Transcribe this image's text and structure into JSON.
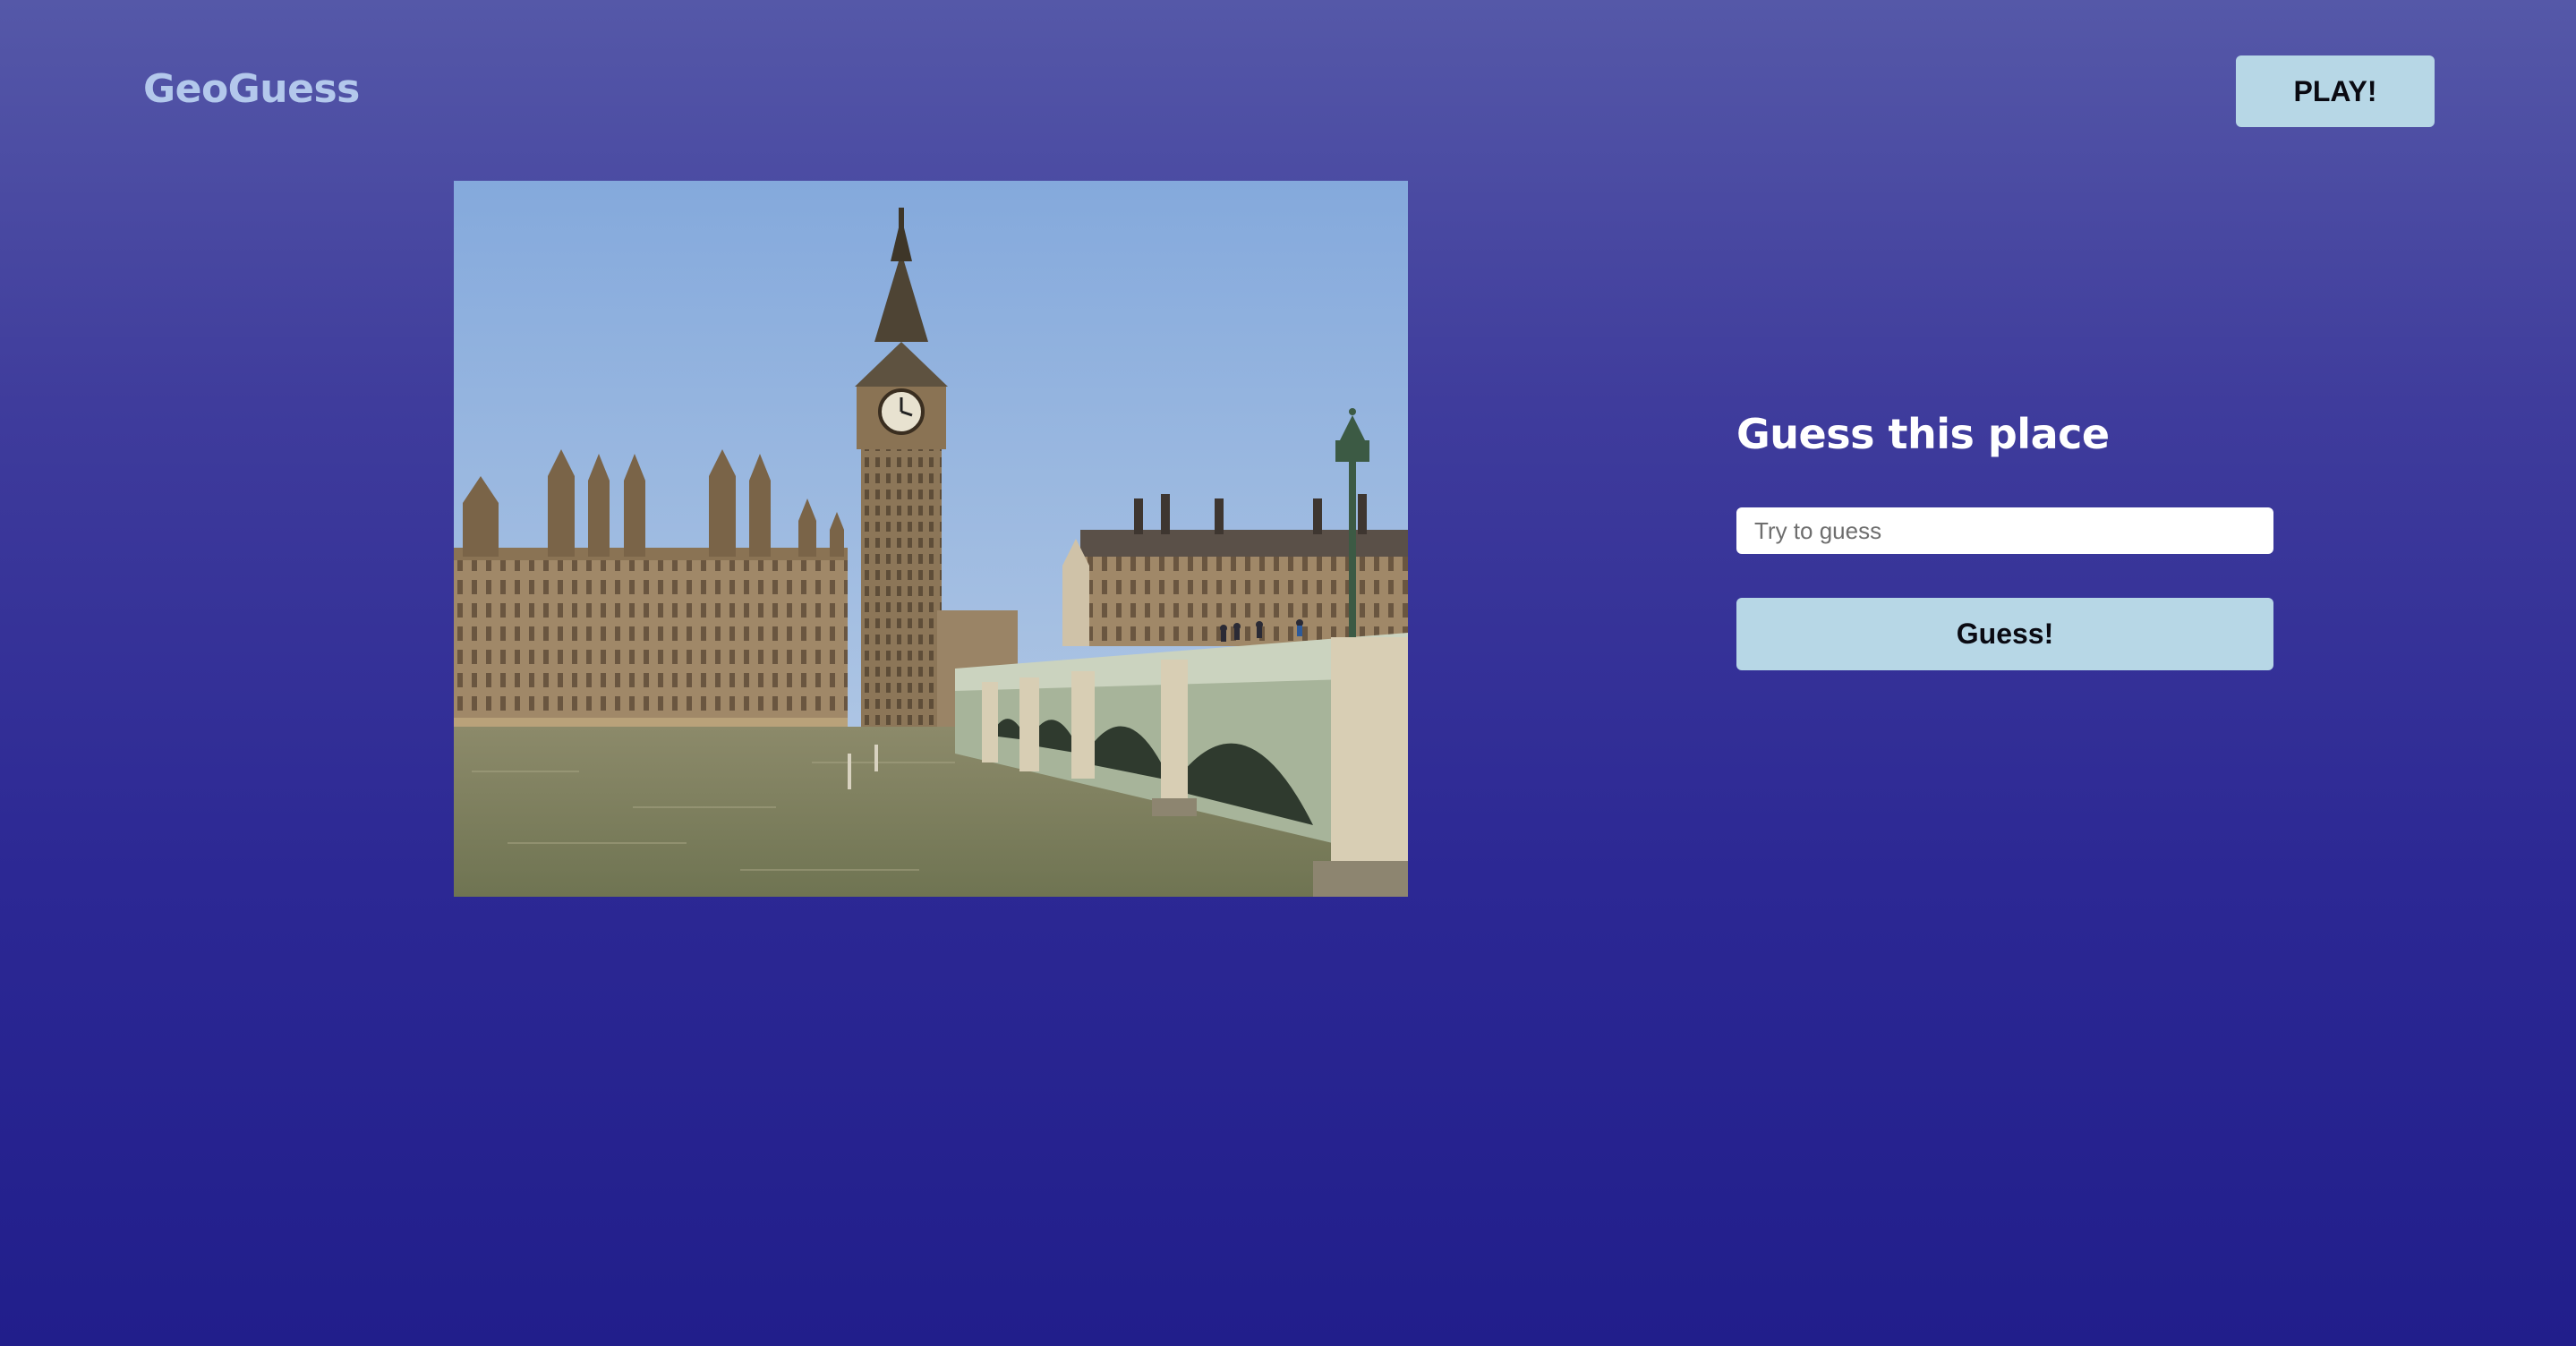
{
  "header": {
    "logo_text": "GeoGuess",
    "play_label": "PLAY!"
  },
  "main": {
    "photo_icon": "landmark-photo",
    "panel": {
      "title": "Guess this place",
      "input_placeholder": "Try to guess",
      "input_value": "",
      "submit_label": "Guess!"
    }
  },
  "colors": {
    "background_top": "#5558a8",
    "background_bottom": "#211e8b",
    "button": "#b7d7e6",
    "logo": "#b3c8ec"
  }
}
